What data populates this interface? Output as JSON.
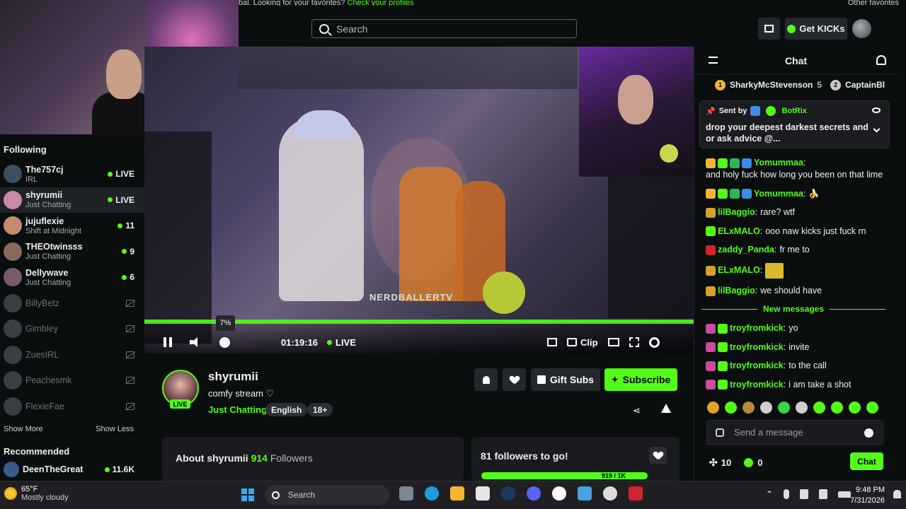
{
  "topbar": {
    "promo_text": "bal. Looking for your favorites?",
    "promo_link": "Check your profiles",
    "promo_right": "Other favorites",
    "search_placeholder": "Search",
    "get_kicks_label": "Get KICKs"
  },
  "sidebar": {
    "following_title": "Following",
    "items": [
      {
        "name": "The757cj",
        "category": "IRL",
        "meta": "LIVE",
        "type": "live"
      },
      {
        "name": "shyrumii",
        "category": "Just Chatting",
        "meta": "LIVE",
        "type": "live"
      },
      {
        "name": "jujuflexie",
        "category": "Shift at Midnight",
        "meta": "11",
        "type": "count"
      },
      {
        "name": "THEOtwinsss",
        "category": "Just Chatting",
        "meta": "9",
        "type": "count"
      },
      {
        "name": "Dellywave",
        "category": "Just Chatting",
        "meta": "6",
        "type": "count"
      },
      {
        "name": "BillyBetz",
        "category": "",
        "meta": "",
        "type": "offline"
      },
      {
        "name": "Gimbley",
        "category": "",
        "meta": "",
        "type": "offline"
      },
      {
        "name": "ZuesIRL",
        "category": "",
        "meta": "",
        "type": "offline"
      },
      {
        "name": "Peachesmk",
        "category": "",
        "meta": "",
        "type": "offline"
      },
      {
        "name": "FlexieFae",
        "category": "",
        "meta": "",
        "type": "offline"
      }
    ],
    "show_more": "Show More",
    "show_less": "Show Less",
    "recommended_title": "Recommended",
    "recommended": [
      {
        "name": "DeenTheGreat",
        "meta": "11.6K"
      }
    ]
  },
  "player": {
    "volume_tooltip": "7%",
    "time": "01:19:16",
    "live_label": "LIVE",
    "clip_label": "Clip",
    "overlay_brand": "NERDBALLERTV"
  },
  "channel": {
    "name": "shyrumii",
    "title": "comfy stream ♡",
    "category": "Just Chatting",
    "tags": [
      "English",
      "18+"
    ],
    "live_badge": "LIVE",
    "gift_subs_label": "Gift Subs",
    "subscribe_label": "Subscribe",
    "about_prefix": "About shyrumii",
    "followers_count": "914",
    "followers_label": "Followers",
    "goal_title": "81 followers to go!",
    "goal_count": "919 / 1K"
  },
  "chat": {
    "title": "Chat",
    "leaderboard": [
      {
        "rank": "1",
        "name": "SharkyMcStevenson",
        "value": "5"
      },
      {
        "rank": "2",
        "name": "CaptainBl"
      }
    ],
    "pinned": {
      "sent_by_label": "Sent by",
      "sender": "BotRix",
      "text": "drop your deepest darkest secrets and or ask advice @..."
    },
    "messages": [
      {
        "user": "Yomummaa",
        "color": "#53fc18",
        "text": "and holy fuck how long you been on that lime"
      },
      {
        "user": "Yomummaa",
        "color": "#53fc18",
        "text": "🍌"
      },
      {
        "user": "lilBaggio",
        "color": "#53fc18",
        "text": "rare? wtf"
      },
      {
        "user": "ELxMALO",
        "color": "#53fc18",
        "text": "ooo naw kicks just fuck rn"
      },
      {
        "user": "zaddy_Panda",
        "color": "#53fc18",
        "text": "fr me to"
      },
      {
        "user": "ELxMALO",
        "color": "#53fc18",
        "text": ""
      },
      {
        "user": "lilBaggio",
        "color": "#53fc18",
        "text": "we should have"
      }
    ],
    "new_messages_label": "New messages",
    "new_messages": [
      {
        "user": "troyfromkick",
        "color": "#53fc18",
        "text": "yo"
      },
      {
        "user": "troyfromkick",
        "color": "#53fc18",
        "text": "invite"
      },
      {
        "user": "troyfromkick",
        "color": "#53fc18",
        "text": "to the call"
      },
      {
        "user": "troyfromkick",
        "color": "#53fc18",
        "text": "i am take a shot"
      }
    ],
    "input_placeholder": "Send a message",
    "points": "10",
    "kicks": "0",
    "chat_button": "Chat"
  },
  "taskbar": {
    "temperature": "65°F",
    "weather": "Mostly cloudy",
    "search_label": "Search",
    "time": "9:48 PM",
    "date": "7/31/2026"
  },
  "colors": {
    "accent": "#53fc18",
    "background": "#0b0e0f",
    "panel": "#191b1f"
  }
}
